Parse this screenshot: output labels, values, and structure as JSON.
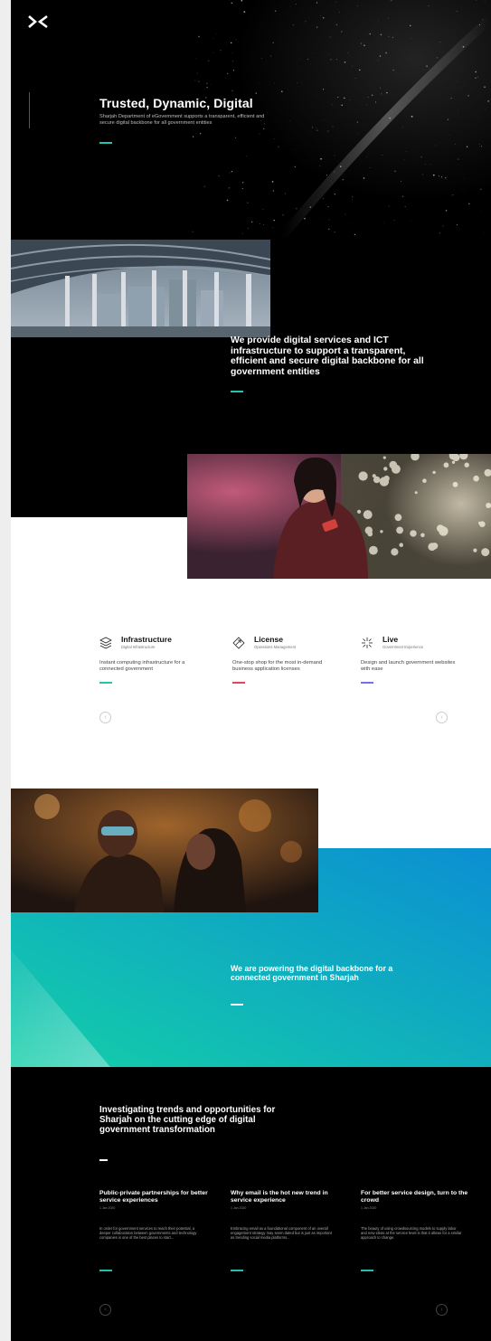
{
  "colors": {
    "teal": "#22c4b2",
    "red": "#e8425a",
    "purple": "#7a6cf0",
    "gradient_start": "#14cfa8",
    "gradient_end": "#0b8fd3"
  },
  "brand": {
    "logo_icon": "x-arrows-logo-icon"
  },
  "hero": {
    "title": "Trusted, Dynamic, Digital",
    "subtitle": "Sharjah Department of eGovernment supports a transparent, efficient and secure digital backbone for all government entities"
  },
  "about": {
    "text": "We provide digital services and ICT infrastructure to support a transparent, efficient and secure digital backbone for all government entities"
  },
  "services": [
    {
      "title": "Infrastructure",
      "subtitle": "Digital Infrastructure",
      "description": "Instant computing infrastructure for a connected government",
      "icon": "layers-icon"
    },
    {
      "title": "License",
      "subtitle": "Operations Management",
      "description": "One-stop shop for the most in-demand business application licenses",
      "icon": "diamond-arrows-icon"
    },
    {
      "title": "Live",
      "subtitle": "Government Experience",
      "description": "Design and launch government websites with ease",
      "icon": "burst-icon"
    }
  ],
  "mission": {
    "text": "We are powering the digital backbone for a connected government in Sharjah"
  },
  "trends": {
    "title": "Investigating trends and opportunities for Sharjah on the cutting edge of digital government transformation",
    "articles": [
      {
        "title": "Public-private partnerships for better service experiences",
        "date": "1 Jan 2020",
        "body": "In order for government services to reach their potential, a deeper collaboration between governments and technology companies is one of the best places to start..."
      },
      {
        "title": "Why email is the hot new trend in service experience",
        "date": "1 Jan 2020",
        "body": "Embracing email as a foundational component of an overall engagement strategy may seem dated but is just as important as trending social media platforms..."
      },
      {
        "title": "For better service design, turn to the crowd",
        "date": "1 Jan 2020",
        "body": "The beauty of using crowdsourcing models to supply labor and new ideas at the service level is that it allows for a similar approach to change."
      }
    ]
  },
  "nav": {
    "prev_icon": "chevron-left-icon",
    "next_icon": "chevron-right-icon",
    "prev_glyph": "‹",
    "next_glyph": "›"
  }
}
